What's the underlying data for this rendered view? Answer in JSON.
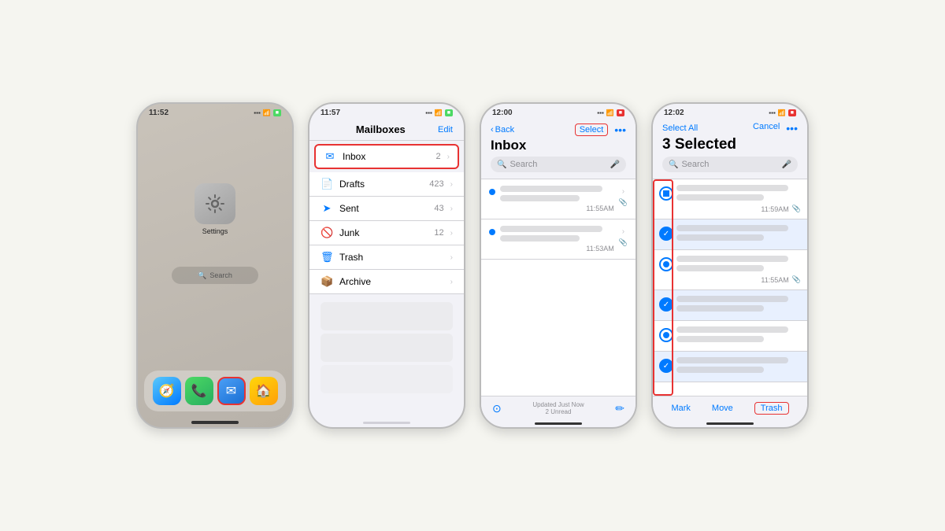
{
  "phone1": {
    "time": "11:52",
    "app_label": "Settings",
    "search_label": "Search",
    "dock": [
      "Safari",
      "Phone",
      "Mail",
      "Home"
    ]
  },
  "phone2": {
    "time": "11:57",
    "title": "Mailboxes",
    "edit_btn": "Edit",
    "rows": [
      {
        "icon": "✉",
        "label": "Inbox",
        "count": "2",
        "highlighted": true
      },
      {
        "icon": "📄",
        "label": "Drafts",
        "count": "423"
      },
      {
        "icon": "➤",
        "label": "Sent",
        "count": "43"
      },
      {
        "icon": "🚫",
        "label": "Junk",
        "count": "12"
      },
      {
        "icon": "🗑",
        "label": "Trash",
        "count": ""
      },
      {
        "icon": "📦",
        "label": "Archive",
        "count": ""
      }
    ]
  },
  "phone3": {
    "time": "12:00",
    "back_label": "Back",
    "select_label": "Select",
    "title": "Inbox",
    "search_placeholder": "Search",
    "emails": [
      {
        "time": "11:55AM"
      },
      {
        "time": "11:53AM"
      }
    ],
    "footer_status": "Updated Just Now",
    "footer_sub": "2 Unread"
  },
  "phone4": {
    "time": "12:02",
    "select_all": "Select All",
    "cancel": "Cancel",
    "title": "3 Selected",
    "search_placeholder": "Search",
    "emails": [
      {
        "time": "11:59AM",
        "checked": true
      },
      {
        "time": "11:55AM",
        "checked": true
      },
      {
        "time": "",
        "checked": true
      }
    ],
    "actions": {
      "mark": "Mark",
      "move": "Move",
      "trash": "Trash"
    }
  }
}
